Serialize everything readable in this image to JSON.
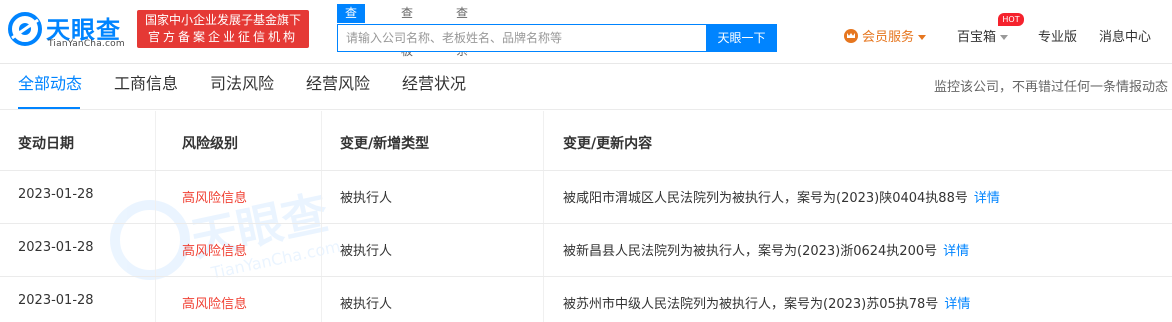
{
  "header": {
    "logo_text": "天眼查",
    "logo_sub": "TianYanCha.com",
    "badge_line1": "国家中小企业发展子基金旗下",
    "badge_line2": "官方备案企业征信机构",
    "search_tabs": [
      "查公司",
      "查老板",
      "查关系"
    ],
    "search_placeholder": "请输入公司名称、老板姓名、品牌名称等",
    "search_button": "天眼一下",
    "nav": {
      "vip": "会员服务",
      "toolbox": "百宝箱",
      "hot_badge": "HOT",
      "pro": "专业版",
      "messages": "消息中心"
    }
  },
  "tabs": [
    "全部动态",
    "工商信息",
    "司法风险",
    "经营风险",
    "经营状况"
  ],
  "monitor_text": "监控该公司，不再错过任何一条情报动态",
  "table": {
    "headers": [
      "变动日期",
      "风险级别",
      "变更/新增类型",
      "变更/更新内容"
    ],
    "rows": [
      {
        "date": "2023-01-28",
        "risk": "高风险信息",
        "type": "被执行人",
        "content": "被咸阳市渭城区人民法院列为被执行人，案号为(2023)陕0404执88号",
        "link": "详情"
      },
      {
        "date": "2023-01-28",
        "risk": "高风险信息",
        "type": "被执行人",
        "content": "被新昌县人民法院列为被执行人，案号为(2023)浙0624执200号",
        "link": "详情"
      },
      {
        "date": "2023-01-28",
        "risk": "高风险信息",
        "type": "被执行人",
        "content": "被苏州市中级人民法院列为被执行人，案号为(2023)苏05执78号",
        "link": "详情"
      }
    ]
  },
  "colors": {
    "brand": "#0084ff",
    "risk": "#f04134",
    "vip": "#e6761f",
    "badge": "#e53935"
  }
}
